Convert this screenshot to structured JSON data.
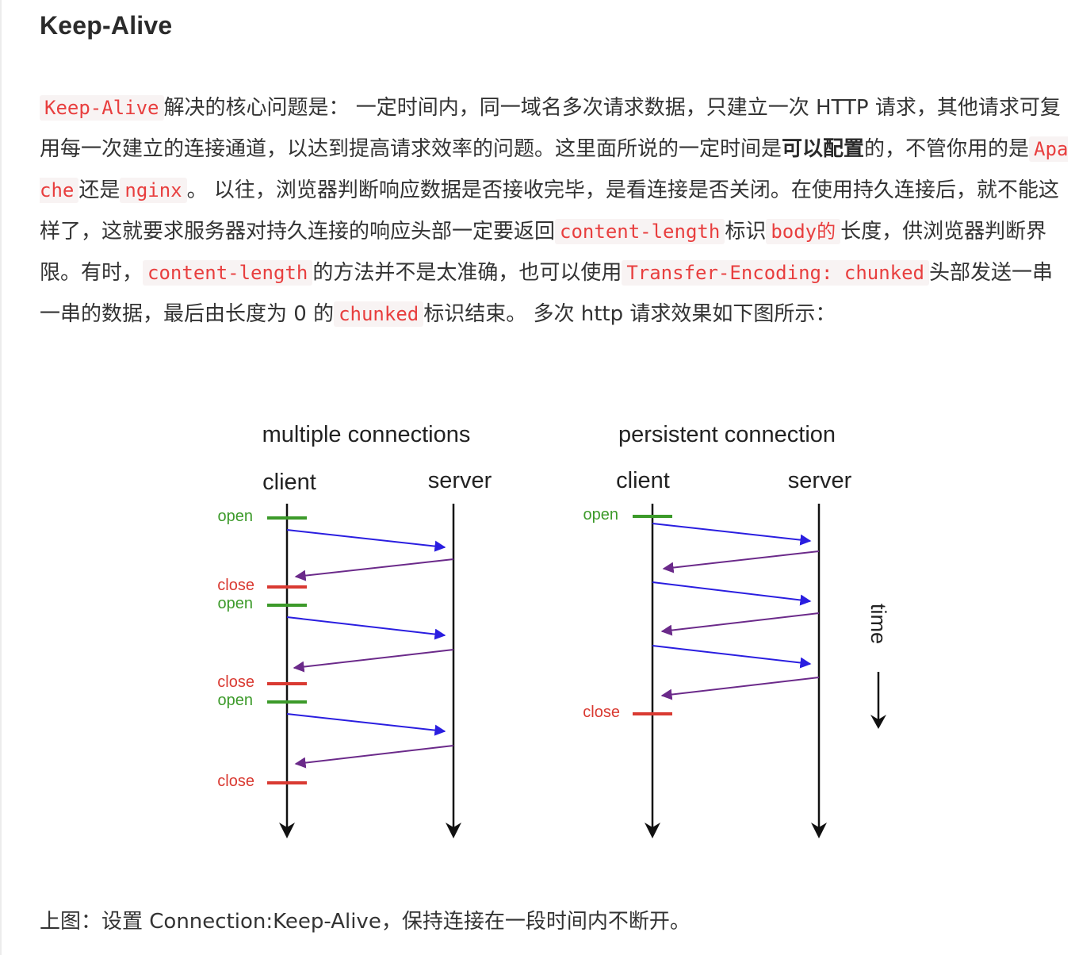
{
  "heading": "Keep-Alive",
  "paragraph": {
    "code_keepalive": "Keep-Alive",
    "t1": "解决的核心问题是： 一定时间内，同一域名多次请求数据，只建立一次 HTTP 请求，其他请求可复用每一次建立的连接通道，以达到提高请求效率的问题。这里面所说的一定时间是",
    "bold_configurable": "可以配置",
    "t2": "的，不管你用的是",
    "code_apache": "Apache",
    "t3": "还是",
    "code_nginx": "nginx",
    "t4": "。 以往，浏览器判断响应数据是否接收完毕，是看连接是否关闭。在使用持久连接后，就不能这样了，这就要求服务器对持久连接的响应头部一定要返回",
    "code_content_length_1": "content-length",
    "t5": "标识",
    "code_body": "body的",
    "t6": "长度，供浏览器判断界限。有时，",
    "code_content_length_2": "content-length",
    "t7": "的方法并不是太准确，也可以使用",
    "code_transfer_encoding": "Transfer-Encoding: chunked",
    "t8": "头部发送一串一串的数据，最后由长度为 0 的",
    "code_chunked": "chunked",
    "t9": "标识结束。 多次 http 请求效果如下图所示："
  },
  "figure": {
    "left_title": "multiple connections",
    "right_title": "persistent connection",
    "client_label": "client",
    "server_label": "server",
    "open_label": "open",
    "close_label": "close",
    "time_label": "time",
    "colors": {
      "open": "#3c9a2a",
      "close": "#d93a32",
      "request": "#2a1ee0",
      "response": "#6b2a8a",
      "axis": "#111111"
    }
  },
  "caption": "上图：设置 Connection:Keep-Alive，保持连接在一段时间内不断开。"
}
